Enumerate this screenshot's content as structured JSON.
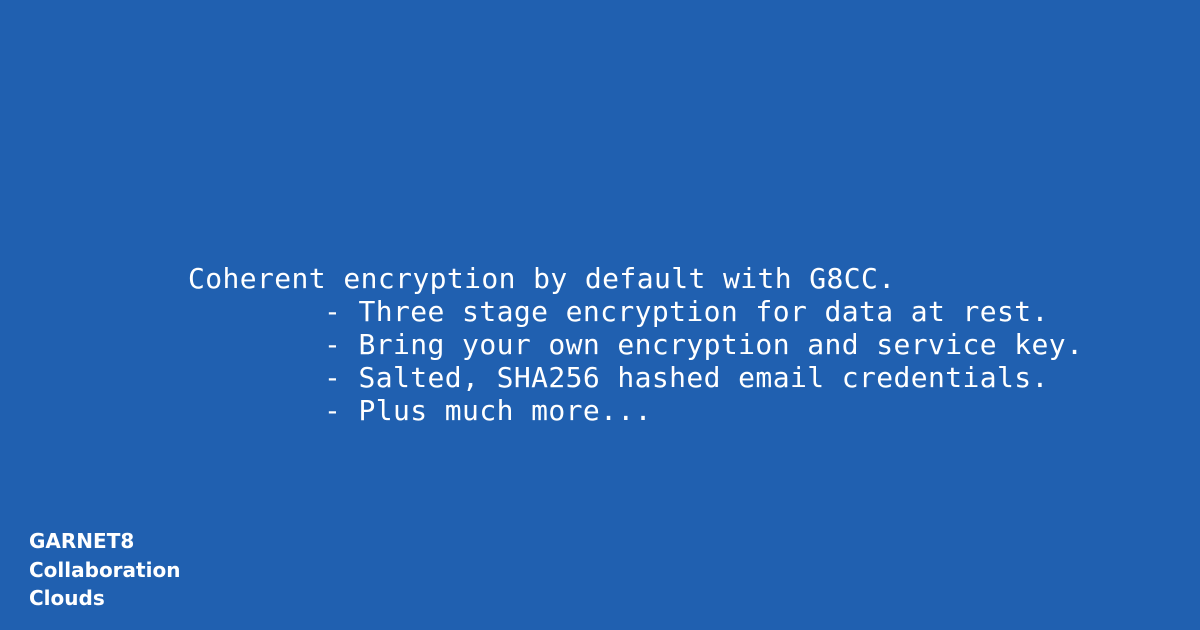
{
  "message": {
    "headline": "Coherent encryption by default with G8CC.",
    "bullets": [
      "- Three stage encryption for data at rest.",
      "- Bring your own encryption and service key.",
      "- Salted, SHA256 hashed email credentials.",
      "- Plus much more..."
    ]
  },
  "brand": {
    "line1": "GARNET8",
    "line2": "Collaboration",
    "line3": "Clouds"
  },
  "colors": {
    "background": "#2060b0",
    "text": "#ffffff"
  }
}
